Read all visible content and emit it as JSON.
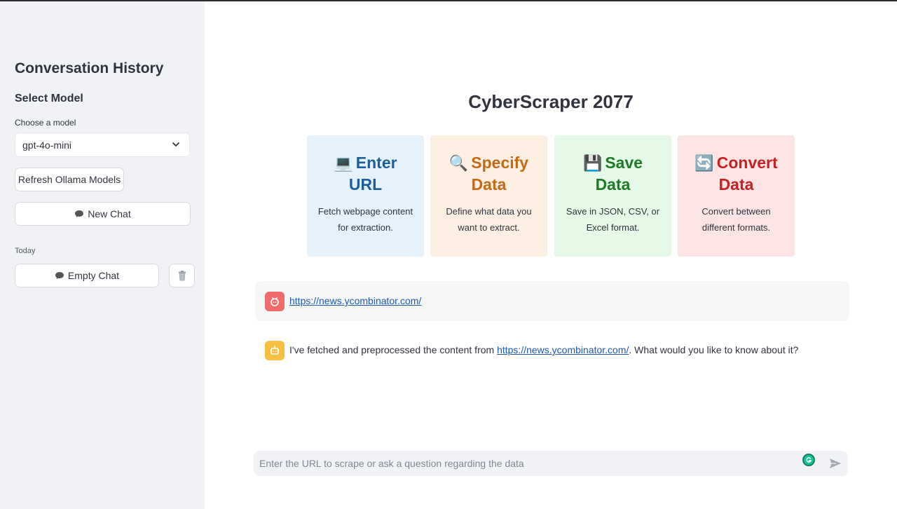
{
  "sidebar": {
    "title": "Conversation History",
    "subtitle": "Select Model",
    "model_label": "Choose a model",
    "model_selected": "gpt-4o-mini",
    "refresh_label": "Refresh Ollama Models",
    "new_chat_label": "New Chat",
    "today_label": "Today",
    "chat_items": [
      {
        "label": "Empty Chat"
      }
    ]
  },
  "main": {
    "title": "CyberScraper 2077",
    "cards": [
      {
        "emoji": "💻",
        "title_line1": "Enter",
        "title_line2": "URL",
        "desc": "Fetch webpage content for extraction.",
        "color": "#1a5f9c",
        "bg": "#e5f1fb"
      },
      {
        "emoji": "🔍",
        "title_line1": "Specify",
        "title_line2": "Data",
        "desc": "Define what data you want to extract.",
        "color": "#c46a16",
        "bg": "#fdf0e2"
      },
      {
        "emoji": "💾",
        "title_line1": "Save",
        "title_line2": "Data",
        "desc": "Save in JSON, CSV, or Excel format.",
        "color": "#1e7a27",
        "bg": "#e4f9e6"
      },
      {
        "emoji": "🔄",
        "title_line1": "Convert",
        "title_line2": "Data",
        "desc": "Convert between different formats.",
        "color": "#c62121",
        "bg": "#fce4e4"
      }
    ],
    "messages": {
      "user_link": "https://news.ycombinator.com/",
      "bot_prefix": "I've fetched and preprocessed the content from ",
      "bot_link": "https://news.ycombinator.com/",
      "bot_suffix": ". What would you like to know about it?"
    },
    "chat_input": {
      "placeholder": "Enter the URL to scrape or ask a question regarding the data",
      "value": ""
    }
  },
  "colors": {
    "sidebar_bg": "#f0f2f6",
    "user_avatar": "#ef6a6a",
    "bot_avatar": "#f5bf42",
    "link": "#1d5aa8"
  },
  "icons": {
    "model_dropdown": "chevron-down-icon",
    "new_chat": "speech-bubble-icon",
    "delete_chat": "trash-icon",
    "user_avatar": "user-avatar-icon",
    "bot_avatar": "bot-avatar-icon",
    "send": "send-icon",
    "grammarly": "grammarly-icon"
  }
}
